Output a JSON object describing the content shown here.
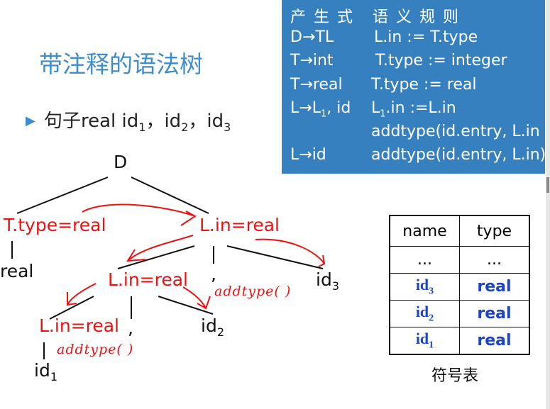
{
  "title": "带注释的语法树",
  "sentence": {
    "prefix": "句子real  id",
    "s1": "1",
    "sep1": "，id",
    "s2": "2",
    "sep2": "，id",
    "s3": "3"
  },
  "rules": {
    "header_prod": "产 生 式",
    "header_rule": "语 义 规 则",
    "rows": [
      {
        "prod": "D→TL",
        "rule": "L.in := T.type"
      },
      {
        "prod": "T→int",
        "rule": "T.type := integer"
      },
      {
        "prod": "T→real",
        "rule": "T.type := real"
      },
      {
        "prod": "L→L",
        "prod_sub": "1",
        "prod_tail": ", id",
        "rule": "L",
        "rule_sub": "1",
        "rule_tail": ".in :=L.in"
      },
      {
        "prod": "",
        "rule": "addtype(id.entry,  L.in"
      },
      {
        "prod": "L→id",
        "rule": "addtype(id.entry, L.in)"
      }
    ]
  },
  "tree": {
    "root": "D",
    "ttype": "T.type=real",
    "lin_top": "L.in=real",
    "real": "real",
    "lin_mid": "L.in=real",
    "comma": ",",
    "id": "id",
    "id3_sub": "3",
    "lin_bot": "L.in=real",
    "id2_sub": "2",
    "id1_sub": "1",
    "note1": "addtype( )",
    "note2": "addtype( )"
  },
  "symtable": {
    "headers": [
      "name",
      "type"
    ],
    "rows": [
      [
        "...",
        "..."
      ],
      [
        "id",
        "3",
        "real"
      ],
      [
        "id",
        "2",
        "real"
      ],
      [
        "id",
        "1",
        "real"
      ]
    ],
    "caption": "符号表"
  }
}
